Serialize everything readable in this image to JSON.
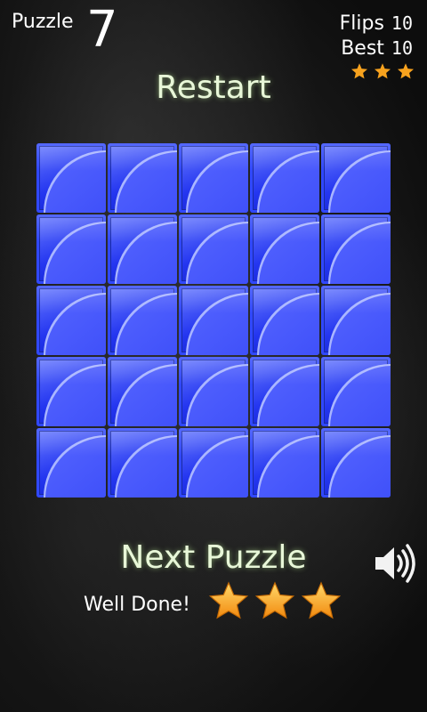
{
  "header": {
    "puzzle_label": "Puzzle",
    "puzzle_number": "7",
    "flips_label": "Flips",
    "flips_value": "10",
    "best_label": "Best",
    "best_value": "10",
    "top_stars": 3
  },
  "restart_label": "Restart",
  "board": {
    "rows": 5,
    "cols": 5,
    "tile_color": "#2436f0",
    "tiles_flipped": 25
  },
  "footer": {
    "next_label": "Next Puzzle",
    "result_text": "Well Done!",
    "result_stars": 3,
    "speaker_icon": "speaker-icon"
  },
  "colors": {
    "star": "#f7a21e",
    "accent_text": "#e8f7d8"
  }
}
